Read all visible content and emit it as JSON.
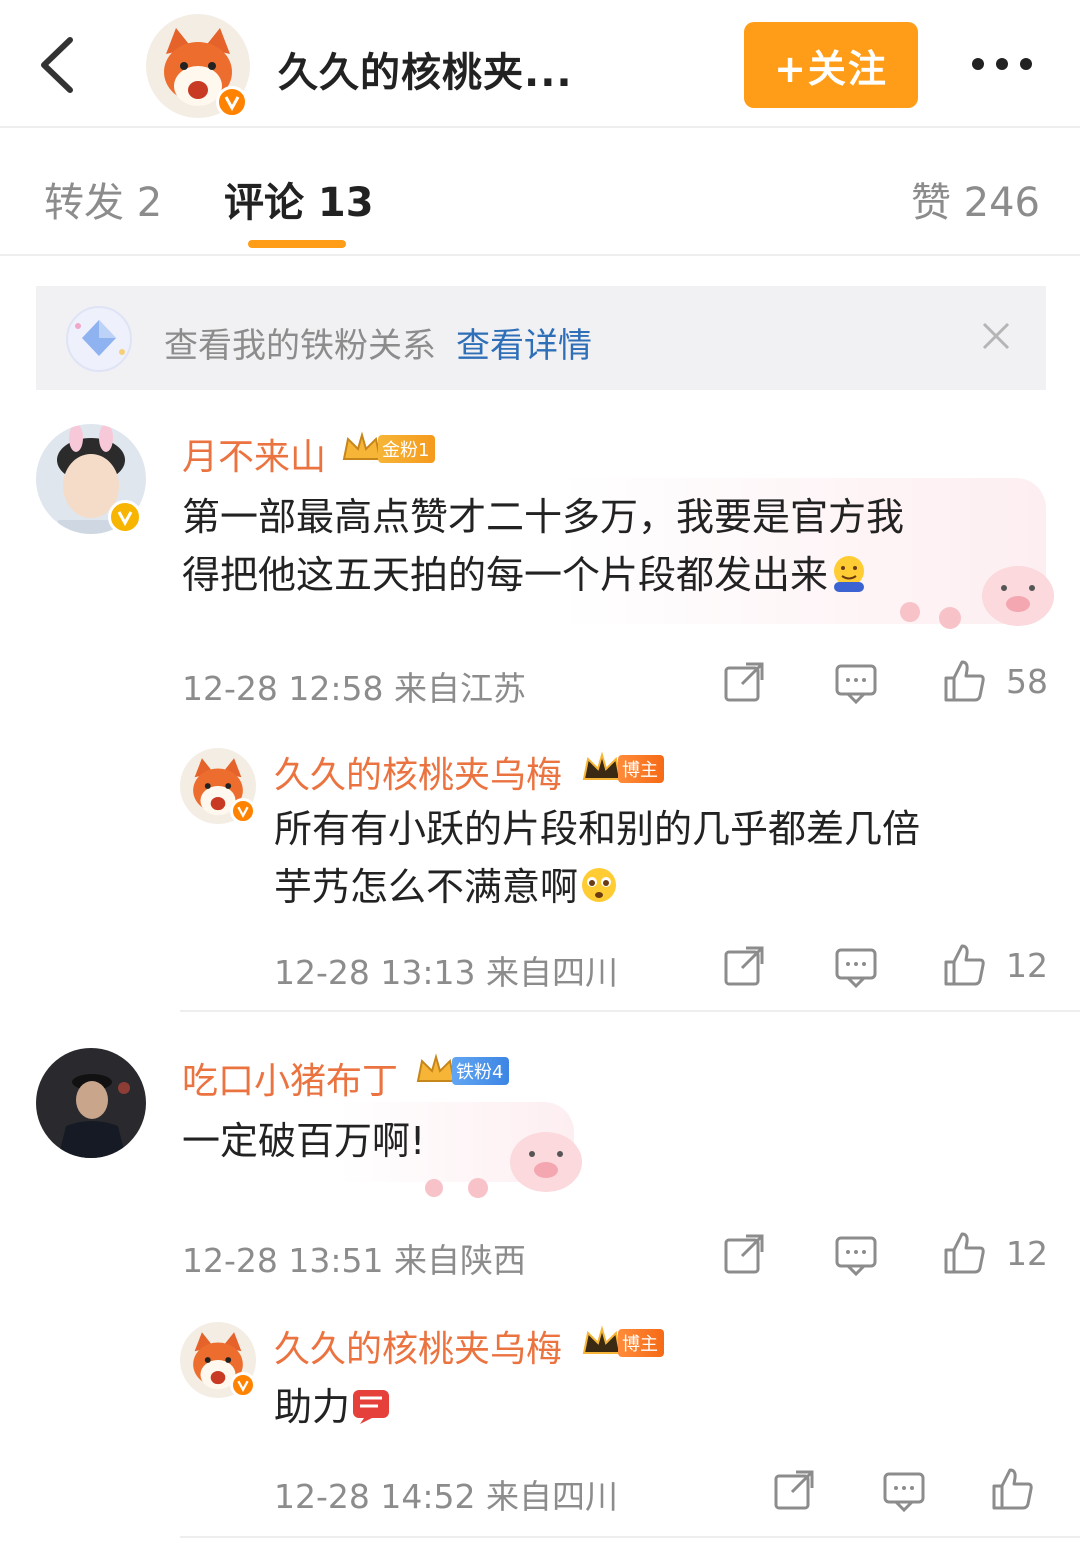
{
  "header": {
    "title": "久久的核桃夹...",
    "follow_label": "+关注",
    "back_icon": "back-arrow-icon",
    "more_icon": "more-dots-icon"
  },
  "tabs": {
    "repost": "转发 2",
    "comment": "评论 13",
    "likes": "赞 246",
    "active_color": "#ff9d18"
  },
  "fans_banner": {
    "text": "查看我的铁粉关系",
    "link": "查看详情"
  },
  "comments": [
    {
      "username": "月不来山",
      "badge": "金粉1",
      "text_line1": "第一部最高点赞才二十多万，我要是官方我",
      "text_line2": "得把他这五天拍的每一个片段都发出来",
      "time_location": "12-28 12:58  来自江苏",
      "likes": "58",
      "reply": {
        "username": "久久的核桃夹乌梅",
        "badge": "博主",
        "text_line1": "所有有小跃的片段和别的几乎都差几倍",
        "text_line2": "芋艿怎么不满意啊",
        "time_location": "12-28 13:13  来自四川",
        "likes": "12"
      }
    },
    {
      "username": "吃口小猪布丁",
      "badge": "铁粉4",
      "text_line1": "一定破百万啊!",
      "time_location": "12-28 13:51  来自陕西",
      "likes": "12",
      "reply": {
        "username": "久久的核桃夹乌梅",
        "badge": "博主",
        "text_line1": "助力",
        "time_location": "12-28 14:52  来自四川"
      }
    }
  ],
  "colors": {
    "username": "#eb7340",
    "link": "#2e6fb8",
    "meta": "#8c8c8c"
  }
}
